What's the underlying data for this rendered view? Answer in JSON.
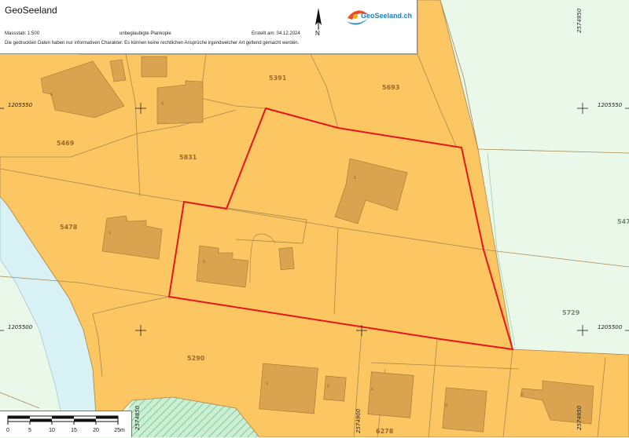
{
  "header": {
    "title": "GeoSeeland",
    "scale": "Massstab: 1:500",
    "plan_note": "unbeglaubigte Plankopie",
    "created": "Erstellt am: 04.12.2024",
    "disclaimer": "Die gedruckten Daten haben nur informativen Charakter. Es können keine rechtlichen Ansprüche irgendwelcher Art geltend gemacht werden.",
    "north_label": "N",
    "logo_text": "GeoSeeland.ch"
  },
  "parcels": [
    "5391",
    "5693",
    "5469",
    "5831",
    "5478",
    "5290",
    "5729",
    "6278",
    "547"
  ],
  "coordinates": {
    "y_north": "1205550",
    "y_south": "1205500",
    "x_left": "2574850",
    "x_middle": "2574900",
    "x_right": "2574950",
    "x_top": "2574950"
  },
  "building_label": "G",
  "scalebar": {
    "ticks": [
      "0",
      "5",
      "10",
      "15",
      "20",
      "25m"
    ]
  },
  "colors": {
    "parcel_fill": "#fcc663",
    "building_fill": "#d9a34f",
    "highlight": "#e8141b",
    "water": "#d8f1f5",
    "green": "#eaf8ea",
    "forest": "#bfe8c8"
  }
}
